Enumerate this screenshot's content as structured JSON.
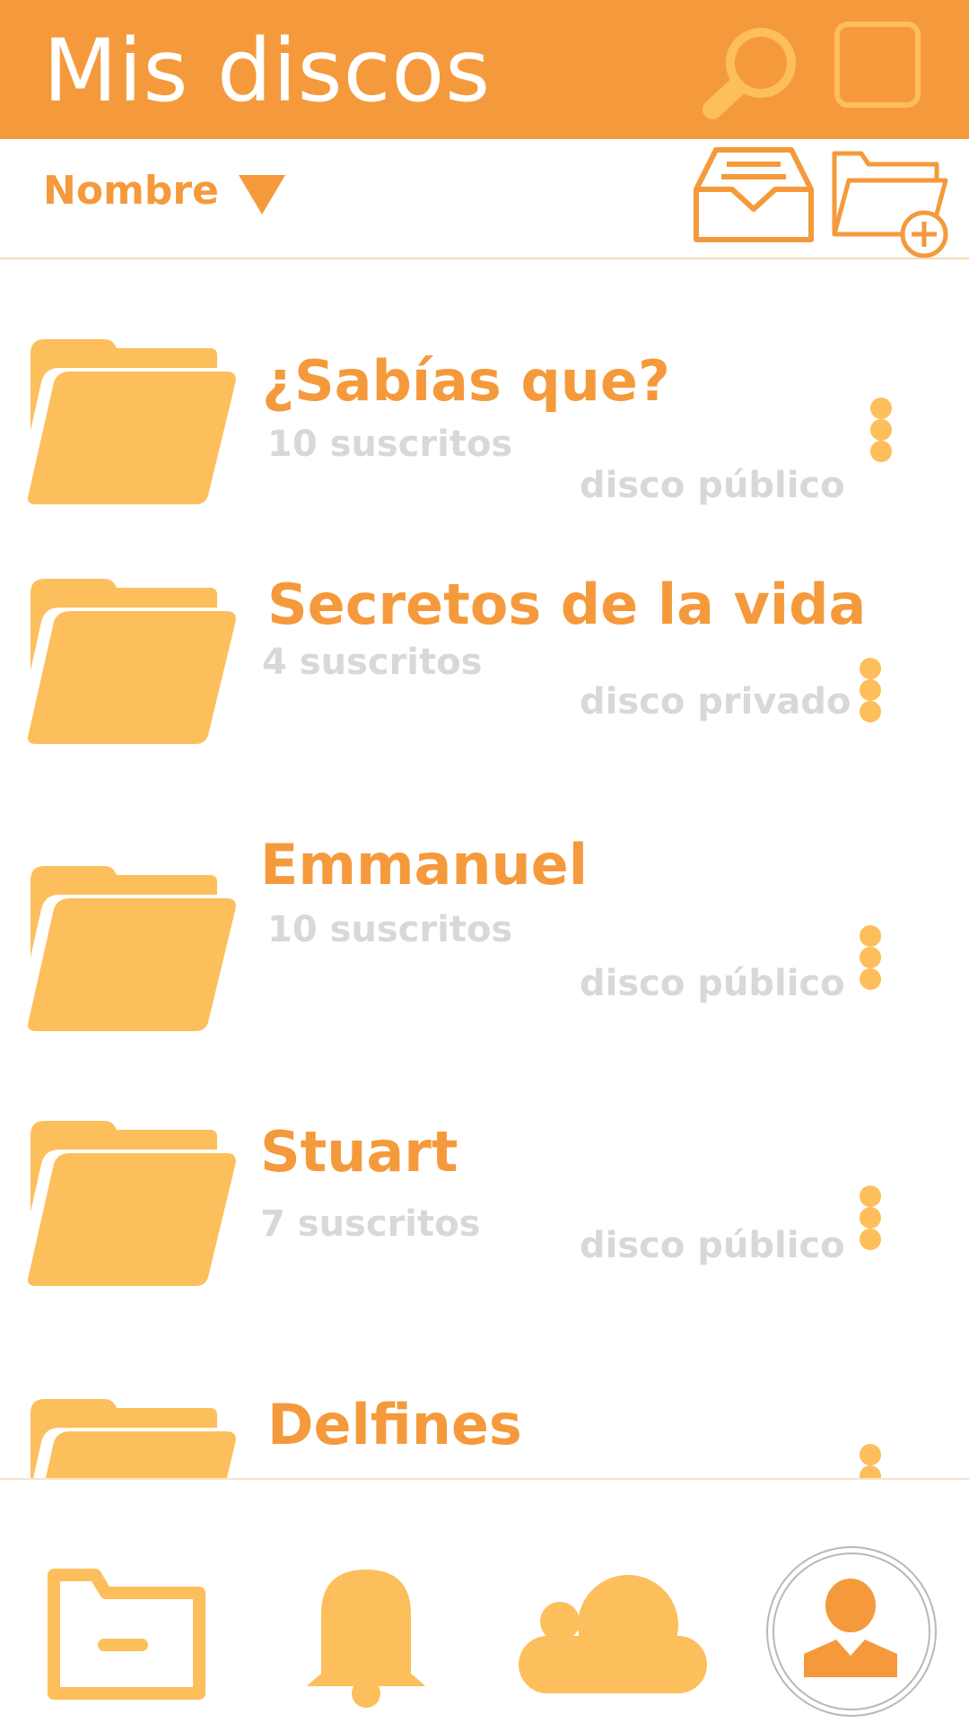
{
  "header": {
    "title": "Mis discos",
    "search_icon": "search-icon",
    "square_icon": "select-all-icon"
  },
  "sortbar": {
    "label": "Nombre",
    "arrow_icon": "triangle-down-icon",
    "inbox_icon": "inbox-icon",
    "new_folder_icon": "folder-add-icon"
  },
  "discs": [
    {
      "name": "¿Sabías que?",
      "subscribers": "10 suscritos",
      "visibility": "disco público"
    },
    {
      "name": "Secretos de la vida",
      "subscribers": "4 suscritos",
      "visibility": "disco privado"
    },
    {
      "name": "Emmanuel",
      "subscribers": "10 suscritos",
      "visibility": "disco público"
    },
    {
      "name": "Stuart",
      "subscribers": "7 suscritos",
      "visibility": "disco público"
    },
    {
      "name": "Delfines"
    }
  ],
  "bottom_nav": {
    "items": [
      "folder-icon",
      "bell-icon",
      "cloud-icon",
      "profile-icon"
    ]
  },
  "colors": {
    "accent": "#F59A3C",
    "folder": "#FDBE5C",
    "muted_text": "#D8D8D8"
  }
}
